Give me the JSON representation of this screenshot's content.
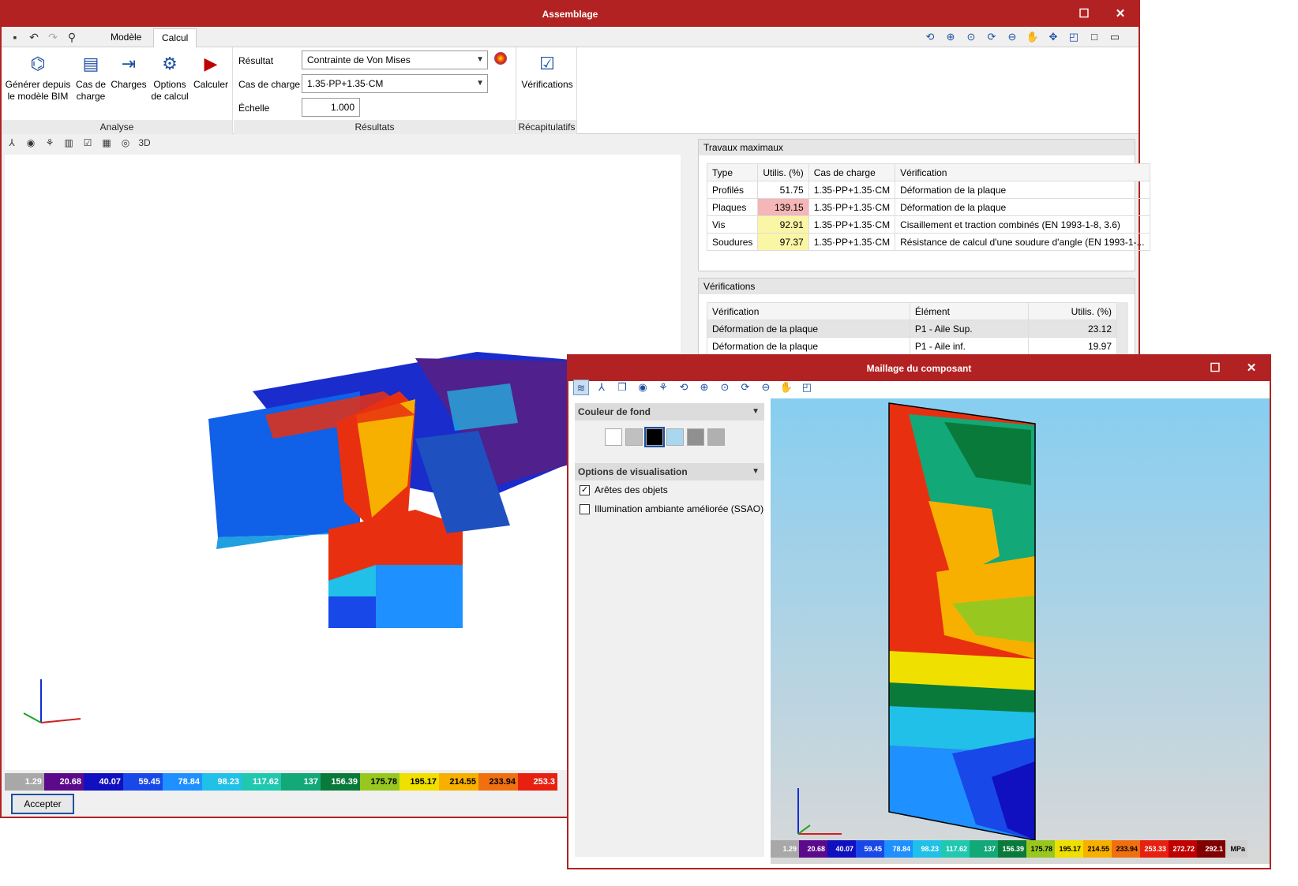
{
  "main": {
    "title": "Assemblage",
    "tabs": [
      "Modèle",
      "Calcul"
    ],
    "ribbon": {
      "analyse": {
        "group_label": "Analyse",
        "buttons": [
          {
            "label": "Générer depuis le modèle BIM",
            "icon": "bim-generate-icon"
          },
          {
            "label": "Cas de charge",
            "icon": "load-case-icon"
          },
          {
            "label": "Charges",
            "icon": "loads-icon"
          },
          {
            "label": "Options de calcul",
            "icon": "gear-icon"
          },
          {
            "label": "Calculer",
            "icon": "play-icon"
          }
        ]
      },
      "resultats": {
        "group_label": "Résultats",
        "resultat_label": "Résultat",
        "resultat_value": "Contrainte de Von Mises",
        "cas_label": "Cas de charge",
        "cas_value": "1.35·PP+1.35·CM",
        "echelle_label": "Échelle",
        "echelle_value": "1.000"
      },
      "recap": {
        "group_label": "Récapitulatifs",
        "verifications_label": "Vérifications"
      }
    },
    "travaux": {
      "title": "Travaux maximaux",
      "headers": [
        "Type",
        "Utilis. (%)",
        "Cas de charge",
        "Vérification"
      ],
      "rows": [
        {
          "type": "Profilés",
          "util": "51.75",
          "cas": "1.35·PP+1.35·CM",
          "verif": "Déformation de la plaque",
          "color": "#ffffff"
        },
        {
          "type": "Plaques",
          "util": "139.15",
          "cas": "1.35·PP+1.35·CM",
          "verif": "Déformation de la plaque",
          "color": "#f4b6b6"
        },
        {
          "type": "Vis",
          "util": "92.91",
          "cas": "1.35·PP+1.35·CM",
          "verif": "Cisaillement et traction combinés (EN 1993-1-8, 3.6)",
          "color": "#fbf5a6"
        },
        {
          "type": "Soudures",
          "util": "97.37",
          "cas": "1.35·PP+1.35·CM",
          "verif": "Résistance de calcul d'une soudure d'angle (EN 1993-1-...",
          "color": "#fbf5a6"
        }
      ]
    },
    "verifications": {
      "title": "Vérifications",
      "headers": [
        "Vérification",
        "Élément",
        "Utilis. (%)"
      ],
      "rows": [
        {
          "verif": "Déformation de la plaque",
          "element": "P1 - Aile Sup.",
          "util": "23.12"
        },
        {
          "verif": "Déformation de la plaque",
          "element": "P1 - Aile inf.",
          "util": "19.97"
        }
      ]
    },
    "legend": {
      "values": [
        "1.29",
        "20.68",
        "40.07",
        "59.45",
        "78.84",
        "98.23",
        "117.62",
        "137",
        "156.39",
        "175.78",
        "195.17",
        "214.55",
        "233.94",
        "253.3"
      ],
      "colors": [
        "#a8a8a8",
        "#5b0a8c",
        "#1010c0",
        "#1848e8",
        "#1e90ff",
        "#20c0e8",
        "#20c8b0",
        "#12a878",
        "#0a7a3a",
        "#98c820",
        "#f0e000",
        "#f8b000",
        "#f07010",
        "#e82010"
      ]
    },
    "accept_label": "Accepter"
  },
  "mesh": {
    "title": "Maillage du composant",
    "bg_section": "Couleur de fond",
    "vis_section": "Options de visualisation",
    "options": [
      {
        "label": "Arêtes des objets",
        "checked": true
      },
      {
        "label": "Illumination ambiante améliorée (SSAO)",
        "checked": false
      }
    ],
    "swatches": [
      "#ffffff",
      "#c0c0c0",
      "#000000",
      "#a8d8f0",
      "#909090",
      "#b0b0b0"
    ],
    "legend": {
      "values": [
        "1.29",
        "20.68",
        "40.07",
        "59.45",
        "78.84",
        "98.23",
        "117.62",
        "137",
        "156.39",
        "175.78",
        "195.17",
        "214.55",
        "233.94",
        "253.33",
        "272.72",
        "292.1"
      ],
      "unit": "MPa",
      "colors": [
        "#a8a8a8",
        "#5b0a8c",
        "#1010c0",
        "#1848e8",
        "#1e90ff",
        "#20c0e8",
        "#20c8b0",
        "#12a878",
        "#0a7a3a",
        "#98c820",
        "#f0e000",
        "#f8b000",
        "#f07010",
        "#e82010",
        "#c00000",
        "#800000"
      ]
    }
  }
}
